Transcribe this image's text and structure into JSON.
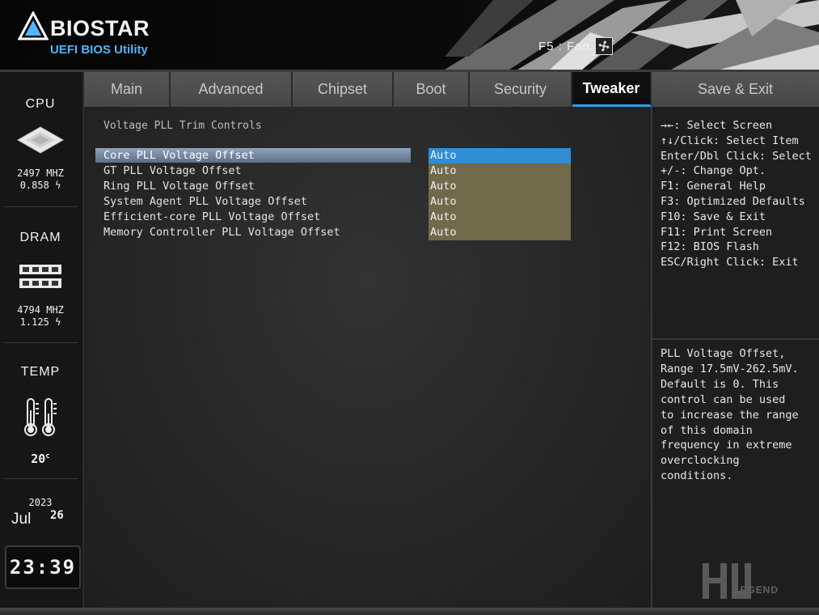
{
  "header": {
    "brand": "BIOSTAR",
    "subtitle": "UEFI BIOS Utility",
    "fan_label": "F5 : Fan"
  },
  "sidebar": {
    "cpu": {
      "label": "CPU",
      "freq": "2497 MHZ",
      "volt": "0.858"
    },
    "dram": {
      "label": "DRAM",
      "freq": "4794 MHZ",
      "volt": "1.125"
    },
    "temp": {
      "label": "TEMP",
      "value": "20"
    },
    "date": {
      "year": "2023",
      "month": "Jul",
      "day": "26"
    },
    "time": "23:39"
  },
  "tabs": [
    {
      "label": "Main",
      "active": false
    },
    {
      "label": "Advanced",
      "active": false
    },
    {
      "label": "Chipset",
      "active": false
    },
    {
      "label": "Boot",
      "active": false
    },
    {
      "label": "Security",
      "active": false
    },
    {
      "label": "Tweaker",
      "active": true
    },
    {
      "label": "Save & Exit",
      "active": false
    }
  ],
  "main": {
    "section_title": "Voltage PLL Trim Controls",
    "items": [
      {
        "label": "Core PLL Voltage Offset",
        "value": "Auto",
        "selected": true
      },
      {
        "label": "GT PLL Voltage Offset",
        "value": "Auto",
        "selected": false
      },
      {
        "label": "Ring PLL Voltage Offset",
        "value": "Auto",
        "selected": false
      },
      {
        "label": "System Agent PLL Voltage Offset",
        "value": "Auto",
        "selected": false
      },
      {
        "label": "Efficient-core PLL Voltage Offset",
        "value": "Auto",
        "selected": false
      },
      {
        "label": "Memory Controller PLL Voltage Offset",
        "value": "Auto",
        "selected": false
      }
    ]
  },
  "help": {
    "keys": [
      "→←: Select Screen",
      "↑↓/Click: Select Item",
      "Enter/Dbl Click: Select",
      "+/-: Change Opt.",
      "F1: General Help",
      "F3: Optimized Defaults",
      "F10: Save & Exit",
      "F11: Print Screen",
      "F12: BIOS Flash",
      "ESC/Right Click: Exit"
    ],
    "description": [
      "PLL Voltage Offset,",
      "Range 17.5mV-262.5mV.",
      "Default is 0. This",
      "control can be used",
      "to increase the range",
      "of this domain",
      "frequency in extreme",
      "overclocking",
      "conditions."
    ]
  },
  "watermark": {
    "text": "LEGEND"
  },
  "colors": {
    "accent_blue": "#2f8ed6",
    "value_bg": "#6e6a4a",
    "logo_blue": "#4fb6ff",
    "active_tab_underline": "#2ba0e6"
  },
  "icons": [
    "biostar-logo-icon",
    "fan-icon",
    "cpu-chip-icon",
    "dram-module-icon",
    "thermometer-icon",
    "bolt-icon"
  ]
}
